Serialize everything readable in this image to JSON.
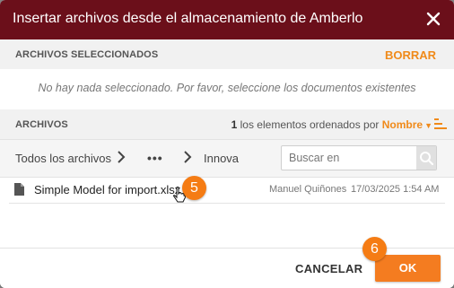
{
  "dialog": {
    "title": "Insertar archivos desde el almacenamiento de Amberlo",
    "colors": {
      "titlebar": "#6b0f1a",
      "accent": "#f08a1a",
      "ok_button": "#f47c20"
    }
  },
  "selected": {
    "label": "ARCHIVOS SELECCIONADOS",
    "clear_label": "BORRAR",
    "empty_message": "No hay nada seleccionado. Por favor, seleccione los documentos existentes"
  },
  "files": {
    "label": "ARCHIVOS",
    "count": "1",
    "count_text": " los elementos ordenados por ",
    "sort_by": "Nombre",
    "sort_caret_icon": "caret-down-icon",
    "sort_order_icon": "sort-lines-icon"
  },
  "breadcrumb": {
    "items": [
      "Todos los archivos",
      "•••",
      "Innova"
    ]
  },
  "search": {
    "placeholder": "Buscar en",
    "value": ""
  },
  "file_list": [
    {
      "name": "Simple Model for import.xlsx",
      "owner": "Manuel Quiñones",
      "date": "17/03/2025 1:54 AM",
      "icon": "file-icon"
    }
  ],
  "footer": {
    "cancel_label": "CANCELAR",
    "ok_label": "OK"
  },
  "annotations": {
    "step_file": "5",
    "step_ok": "6"
  }
}
